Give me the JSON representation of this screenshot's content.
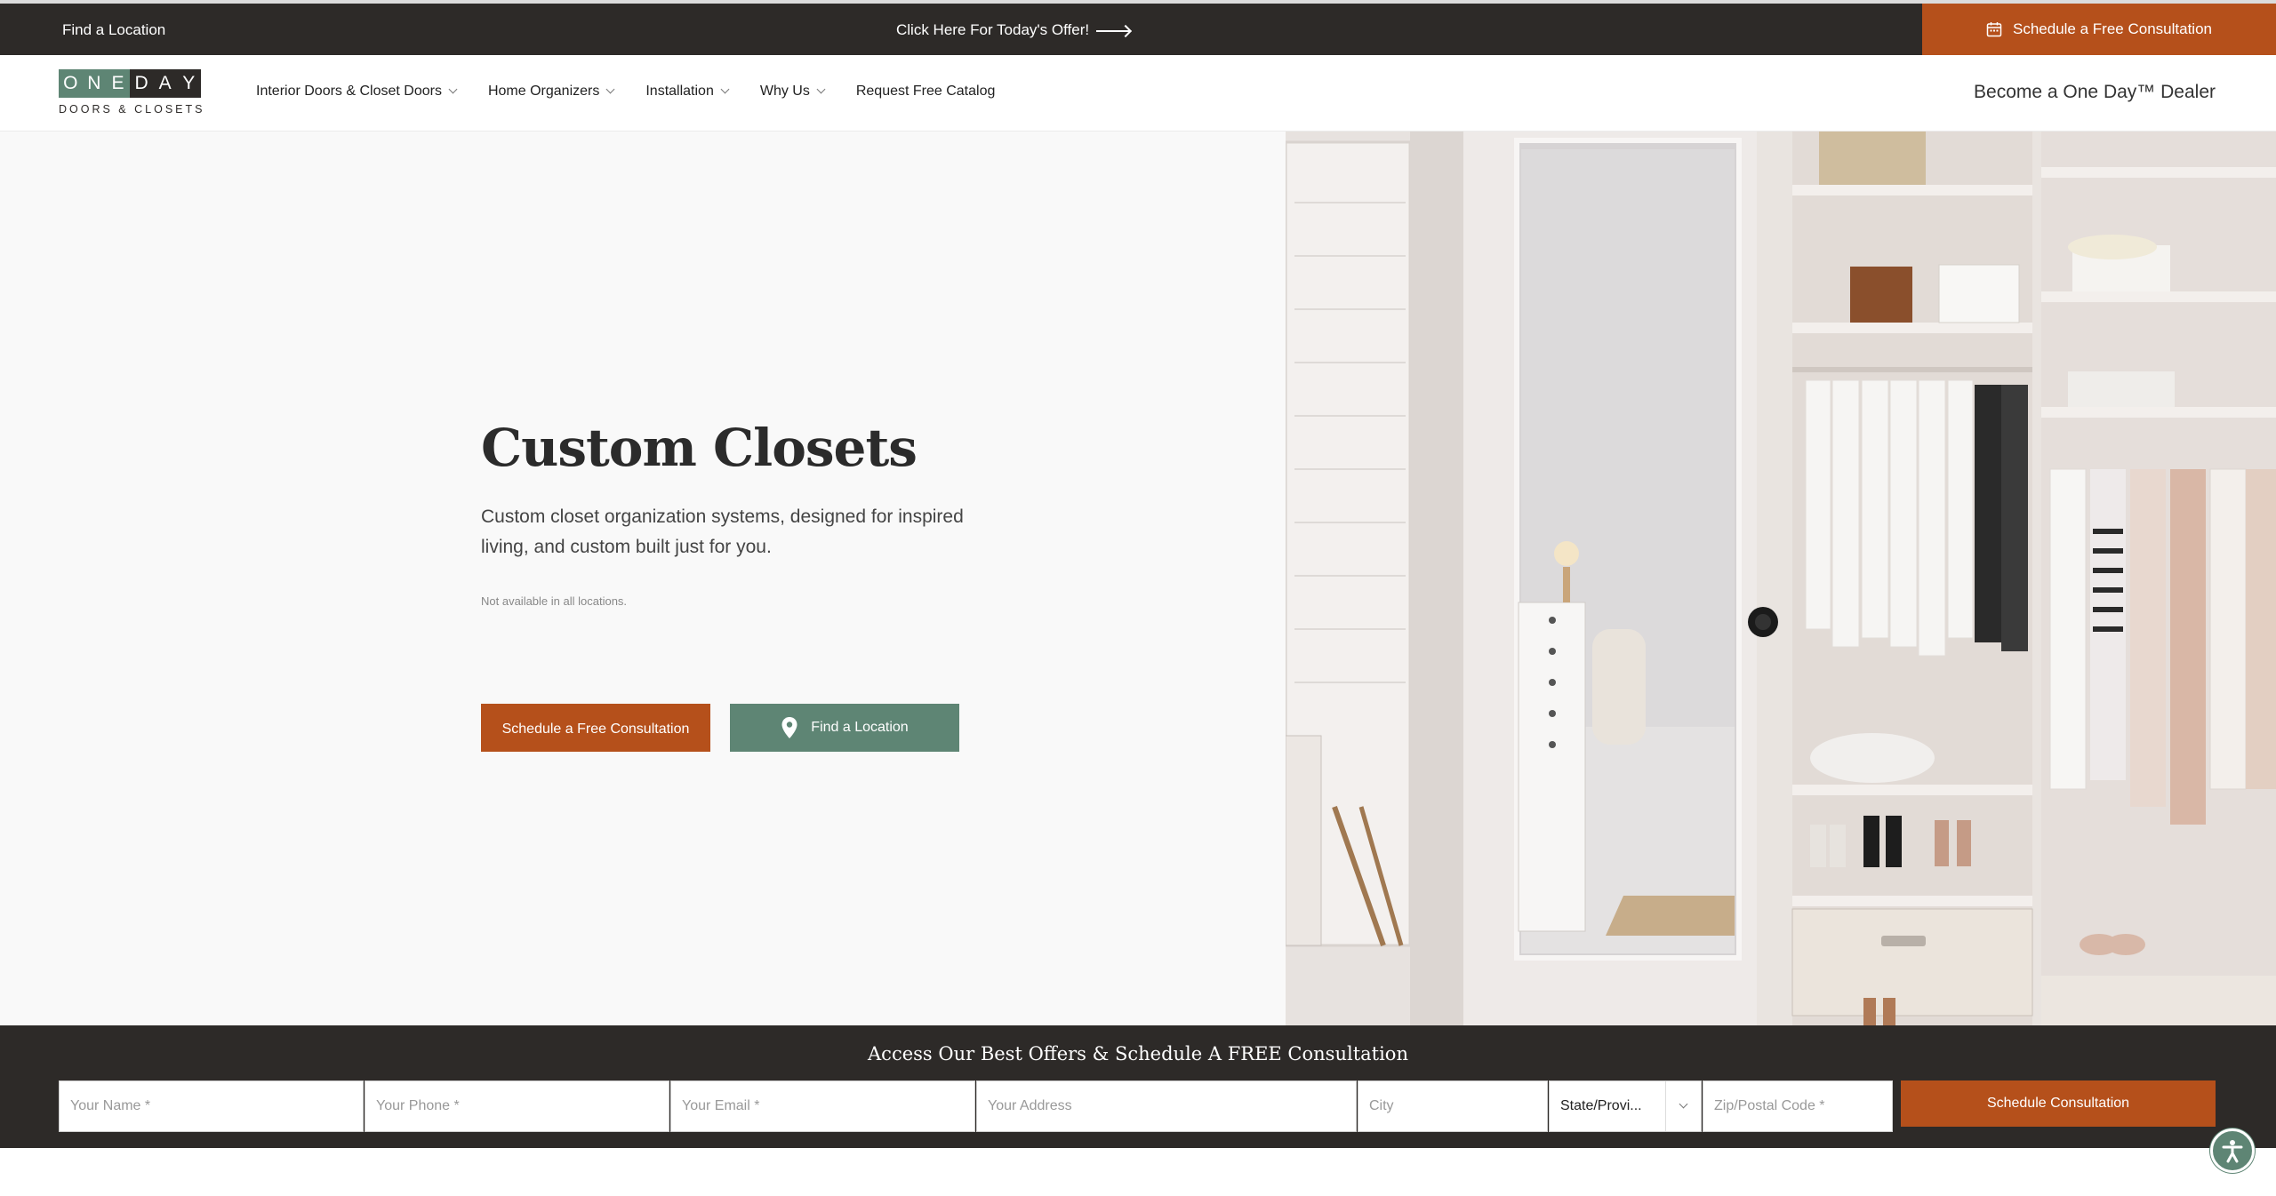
{
  "topbar": {
    "find_location": "Find a Location",
    "offer": "Click Here For Today's Offer!",
    "schedule": "Schedule a Free Consultation"
  },
  "nav": {
    "logo_letters": [
      "O",
      "N",
      "E",
      "D",
      "A",
      "Y"
    ],
    "logo_sub": "DOORS & CLOSETS",
    "items": [
      {
        "label": "Interior Doors & Closet Doors",
        "dropdown": true
      },
      {
        "label": "Home Organizers",
        "dropdown": true
      },
      {
        "label": "Installation",
        "dropdown": true
      },
      {
        "label": "Why Us",
        "dropdown": true
      },
      {
        "label": "Request Free Catalog",
        "dropdown": false
      }
    ],
    "dealer": "Become a One Day™ Dealer"
  },
  "hero": {
    "title": "Custom Closets",
    "description": "Custom closet organization systems, designed for inspired living, and custom built just for you.",
    "note": "Not available in all locations.",
    "schedule_button": "Schedule a Free Consultation",
    "find_button": "Find a Location"
  },
  "form": {
    "title": "Access Our Best Offers & Schedule A FREE Consultation",
    "name_placeholder": "Your Name *",
    "phone_placeholder": "Your Phone *",
    "email_placeholder": "Your Email *",
    "address_placeholder": "Your Address",
    "city_placeholder": "City",
    "state_value": "State/Provi...",
    "zip_placeholder": "Zip/Postal Code *",
    "submit": "Schedule Consultation"
  },
  "colors": {
    "brand_orange": "#b5501b",
    "brand_green": "#5e8574",
    "dark": "#2d2a28"
  }
}
